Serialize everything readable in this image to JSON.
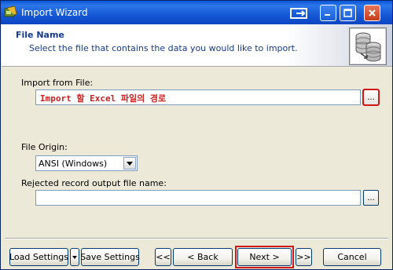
{
  "window": {
    "title": "Import Wizard"
  },
  "header": {
    "title": "File Name",
    "subtitle": "Select the file that contains the data you would like to import.",
    "icon": "database-icon"
  },
  "form": {
    "import_from_file_label": "Import from File:",
    "import_from_file_value": "Import 할 Excel 파일의 경로",
    "browse_label": "...",
    "file_origin_label": "File Origin:",
    "file_origin_value": "ANSI (Windows)",
    "rejected_label": "Rejected record output file name:",
    "rejected_value": "",
    "rejected_browse_label": "..."
  },
  "buttons": {
    "load_settings": "Load Settings",
    "save_settings": "Save Settings",
    "first": "<<",
    "back": "< Back",
    "next": "Next >",
    "last": ">>",
    "cancel": "Cancel"
  },
  "colors": {
    "highlight": "#d01818",
    "title_bar": "#0a56d9",
    "header_text": "#163c8a"
  }
}
